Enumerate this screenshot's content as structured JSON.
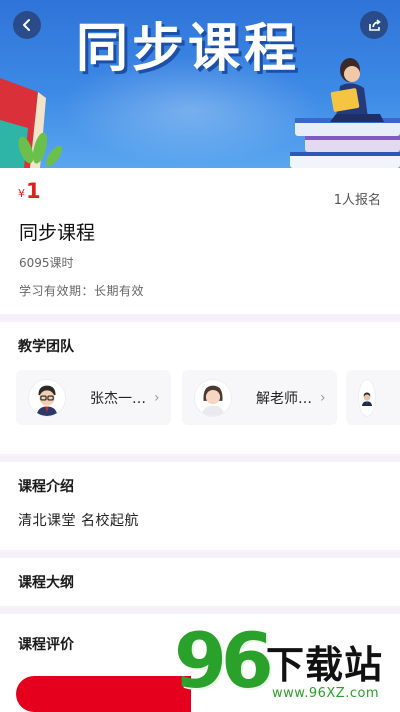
{
  "header": {
    "banner_title": "同步课程"
  },
  "course": {
    "price_symbol": "¥",
    "price": "1",
    "enroll_count": "1人报名",
    "title": "同步课程",
    "hours": "6095课时",
    "validity": "学习有效期：长期有效"
  },
  "team": {
    "title": "教学团队",
    "teachers": [
      {
        "name": "张杰一…"
      },
      {
        "name": "解老师…"
      },
      {
        "name": ""
      }
    ]
  },
  "intro": {
    "title": "课程介绍",
    "text": "清北课堂 名校起航"
  },
  "outline": {
    "title": "课程大纲"
  },
  "reviews": {
    "title": "课程评价"
  },
  "watermark": {
    "number": "96",
    "text": "下载站",
    "url": "www.96XZ.com"
  },
  "colors": {
    "price": "#e02020",
    "banner": "#3d8ae6",
    "watermark_green": "#2aa12a"
  }
}
